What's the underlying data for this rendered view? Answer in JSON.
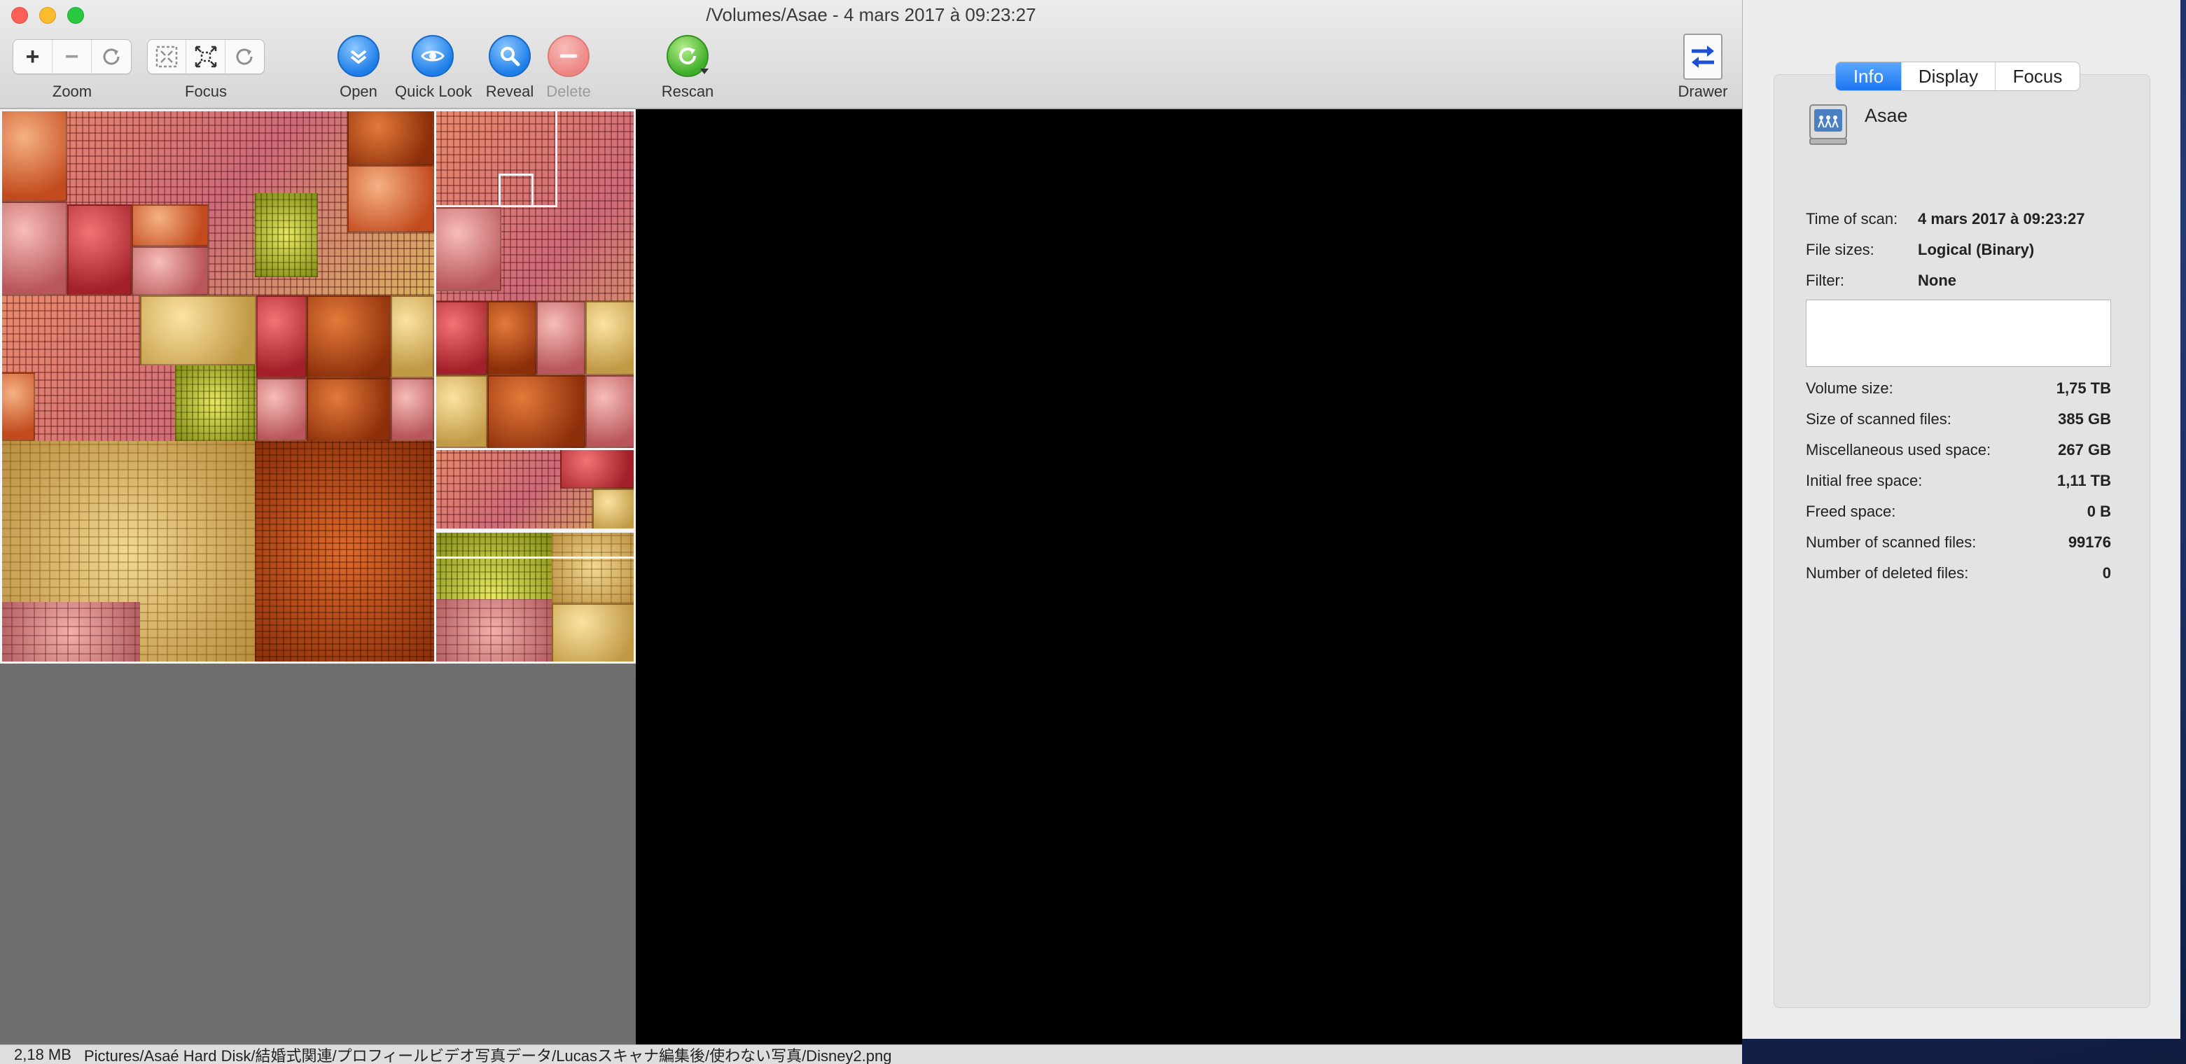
{
  "window": {
    "title": "/Volumes/Asae - 4 mars 2017 à 09:23:27"
  },
  "toolbar": {
    "zoom_label": "Zoom",
    "focus_label": "Focus",
    "open_label": "Open",
    "quick_look_label": "Quick Look",
    "reveal_label": "Reveal",
    "delete_label": "Delete",
    "rescan_label": "Rescan",
    "drawer_label": "Drawer",
    "zoom_in_symbol": "+",
    "zoom_out_symbol": "−"
  },
  "status_bar": {
    "size": "2,18 MB",
    "path": "Pictures/Asaé Hard Disk/結婚式関連/プロフィールビデオ写真データ/Lucasスキャナ編集後/使わない写真/Disney2.png"
  },
  "drawer": {
    "tabs": [
      {
        "label": "Info",
        "active": true
      },
      {
        "label": "Display",
        "active": false
      },
      {
        "label": "Focus",
        "active": false
      }
    ],
    "volume_name": "Asae",
    "scan_info": [
      {
        "label": "Time of scan:",
        "value": "4 mars 2017 à 09:23:27"
      },
      {
        "label": "File sizes:",
        "value": "Logical (Binary)"
      },
      {
        "label": "Filter:",
        "value": "None"
      }
    ],
    "filter_text": "",
    "sizes": [
      {
        "label": "Volume size:",
        "value": "1,75 TB"
      },
      {
        "label": "Size of scanned files:",
        "value": "385 GB"
      },
      {
        "label": "Miscellaneous used space:",
        "value": "267 GB"
      },
      {
        "label": "Initial free space:",
        "value": "1,11 TB"
      },
      {
        "label": "Freed space:",
        "value": "0 B"
      },
      {
        "label": "Number of scanned files:",
        "value": "99176"
      },
      {
        "label": "Number of deleted files:",
        "value": "0"
      }
    ]
  },
  "colors": {
    "accent_tab": "#1c76f2",
    "treemap_background_pane": "#6e6e6e",
    "view_background": "#000000"
  }
}
